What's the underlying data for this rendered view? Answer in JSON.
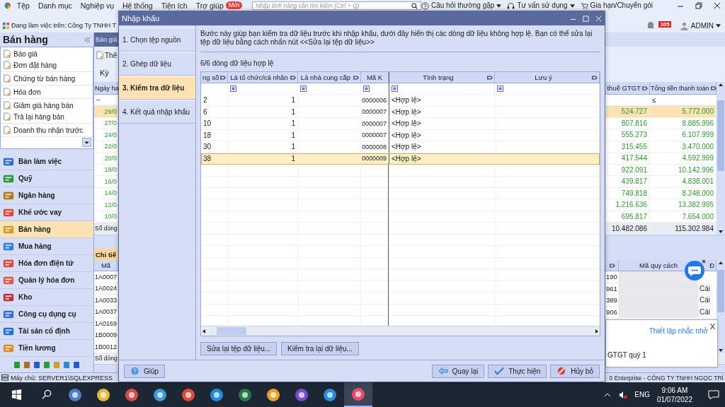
{
  "app_menu": {
    "items": [
      "Tệp",
      "Danh mục",
      "Nghiệp vụ",
      "Hệ thống",
      "Tiện ích",
      "Trợ giúp"
    ],
    "new_badge": "Mới",
    "search_placeholder": "Nhập tính năng cần tìm kiếm (Ctrl + Q)",
    "right_items": [
      {
        "label": "Câu hỏi thường gặp",
        "kind": "help"
      },
      {
        "label": "Tư vấn sử dụng",
        "kind": "headset"
      },
      {
        "label": "Gia hạn/Chuyển gói",
        "kind": "cart"
      }
    ]
  },
  "workspace": {
    "label": "Đang làm việc trên:",
    "company": "Công Ty TNHH T",
    "notification_count": "105",
    "user": "ADMIN"
  },
  "sidebar": {
    "title": "Bán hàng",
    "document_groups": [
      [
        "Báo giá",
        "Đơn đặt hàng"
      ],
      [
        "Chứng từ bán hàng"
      ],
      [
        "Hóa đơn"
      ],
      [
        "Giảm giá hàng bán",
        "Trả lại hàng bán"
      ],
      [
        "Doanh thu nhận trước"
      ]
    ],
    "modules": [
      {
        "label": "Bàn làm việc",
        "kind": "desk",
        "selected": false
      },
      {
        "label": "Quỹ",
        "kind": "fund",
        "selected": false
      },
      {
        "label": "Ngân hàng",
        "kind": "bank",
        "selected": false
      },
      {
        "label": "Khế ước vay",
        "kind": "loan",
        "selected": false
      },
      {
        "label": "Bán hàng",
        "kind": "shop",
        "selected": true
      },
      {
        "label": "Mua hàng",
        "kind": "cart",
        "selected": false
      },
      {
        "label": "Hóa đơn điện tử",
        "kind": "einvoice",
        "selected": false
      },
      {
        "label": "Quản lý hóa đơn",
        "kind": "invoice",
        "selected": false
      },
      {
        "label": "Kho",
        "kind": "warehouse",
        "selected": false
      },
      {
        "label": "Công cụ dụng cụ",
        "kind": "tools",
        "selected": false
      },
      {
        "label": "Tài sản cố định",
        "kind": "car",
        "selected": false
      },
      {
        "label": "Tiền lương",
        "kind": "salary",
        "selected": false
      }
    ]
  },
  "list_view": {
    "tab": "Báo giá",
    "toolbar_item": "Thê",
    "period_label": "Kỳ",
    "columns": [
      "Ngày ha",
      "thuế GTGT",
      "Tổng tiền thanh toán"
    ],
    "filters": [
      "−",
      "≤"
    ],
    "rows": [
      {
        "date": "29/0",
        "tax": "524.727",
        "total": "5.772.000",
        "selected": true
      },
      {
        "date": "27/0",
        "tax": "807.816",
        "total": "8.885.996",
        "selected": false
      },
      {
        "date": "24/0",
        "tax": "555.273",
        "total": "6.107.999",
        "selected": false
      },
      {
        "date": "22/0",
        "tax": "315.455",
        "total": "3.470.000",
        "selected": false
      },
      {
        "date": "20/0",
        "tax": "417.544",
        "total": "4.592.999",
        "selected": false
      },
      {
        "date": "18/0",
        "tax": "922.091",
        "total": "10.142.996",
        "selected": false
      },
      {
        "date": "16/0",
        "tax": "439.817",
        "total": "4.838.001",
        "selected": false
      },
      {
        "date": "14/0",
        "tax": "749.818",
        "total": "8.248.000",
        "selected": false
      },
      {
        "date": "12/0",
        "tax": "1.216.636",
        "total": "13.382.995",
        "selected": false
      },
      {
        "date": "10/0",
        "tax": "695.817",
        "total": "7.654.000",
        "selected": false
      }
    ],
    "summary_label": "Số dòng",
    "totals": [
      "10.482.086",
      "115.302.984"
    ]
  },
  "detail_view": {
    "title": "Chi tiế",
    "columns": [
      "Mã",
      "Mã quy cách",
      "Đ"
    ],
    "rows": [
      {
        "code": "1A0007",
        "code_tail": "190"
      },
      {
        "code": "1A0024",
        "code_tail": "961",
        "unit": "Cái"
      },
      {
        "code": "1A0033",
        "code_tail": "389",
        "unit": "Cái"
      },
      {
        "code": "1A0037",
        "code_tail": "906",
        "unit": "Cái"
      },
      {
        "code": "1A0169"
      },
      {
        "code": "1B0009"
      },
      {
        "code": "1B0012"
      }
    ],
    "summary_label": "Số dòng"
  },
  "reminder": {
    "link": "Thiết lập nhắc nhở",
    "close": "X",
    "text": "GTGT quý 1"
  },
  "dialog": {
    "title": "Nhập khẩu",
    "steps": [
      {
        "label": "1. Chọn tệp nguồn",
        "selected": false
      },
      {
        "label": "2. Ghép dữ liệu",
        "selected": false
      },
      {
        "label": "3. Kiểm tra dữ liệu",
        "selected": true
      },
      {
        "label": "4. Kết quả nhập khẩu",
        "selected": false
      }
    ],
    "description": "Bước này giúp bạn kiểm tra dữ liệu trước khi nhập khẩu, dưới đây hiển thị các dòng dữ liệu không hợp lệ. Bạn có thể sửa lại tệp dữ liệu bằng cách nhấn nút <<Sửa lại tệp dữ liệu>>",
    "valid_count": "6/6 dòng dữ liệu hợp lệ",
    "columns": [
      "ng số",
      "Là tổ chức/cá nhân",
      "Là nhà cung cấp",
      "Mã K",
      "Tình trạng",
      "Lưu ý"
    ],
    "rows": [
      {
        "line": "2",
        "is_org": "1",
        "code": "0000006",
        "status": "<Hợp lệ>",
        "selected": false
      },
      {
        "line": "6",
        "is_org": "1",
        "code": "0000007",
        "status": "<Hợp lệ>",
        "selected": false
      },
      {
        "line": "10",
        "is_org": "1",
        "code": "0000007",
        "status": "<Hợp lệ>",
        "selected": false
      },
      {
        "line": "18",
        "is_org": "1",
        "code": "0000007",
        "status": "<Hợp lệ>",
        "selected": false
      },
      {
        "line": "30",
        "is_org": "1",
        "code": "0000008",
        "status": "<Hợp lệ>",
        "selected": false
      },
      {
        "line": "38",
        "is_org": "1",
        "code": "0000009",
        "status": "<Hợp lệ>",
        "selected": true
      }
    ],
    "actions": [
      "Sửa lại tệp dữ liệu...",
      "Kiểm tra lại dữ liệu..."
    ],
    "help": "Giúp",
    "footer_buttons": [
      {
        "label": "Quay lại",
        "kind": "back"
      },
      {
        "label": "Thực hiện",
        "kind": "execute"
      },
      {
        "label": "Hủy bỏ",
        "kind": "cancel"
      }
    ]
  },
  "status_bar": {
    "server": "Máy chủ: SERVER1\\SQLEXPRESS",
    "product": "0 Enterprise - CÔNG TY TNHH NGỌC TRÍ"
  },
  "taskbar": {
    "apps": [
      {
        "kind": "server",
        "selected": false
      },
      {
        "kind": "folder",
        "selected": false
      },
      {
        "kind": "paint",
        "selected": false
      },
      {
        "kind": "photos",
        "selected": false
      },
      {
        "kind": "chrome",
        "selected": false
      },
      {
        "kind": "chat",
        "selected": false
      },
      {
        "kind": "sheet",
        "selected": false
      },
      {
        "kind": "ribbon",
        "selected": false
      },
      {
        "kind": "phone",
        "selected": false
      },
      {
        "kind": "remote",
        "selected": false
      },
      {
        "kind": "app",
        "selected": true
      }
    ],
    "language": "ENG",
    "time": "9:06 AM",
    "date": "01/07/2022"
  }
}
